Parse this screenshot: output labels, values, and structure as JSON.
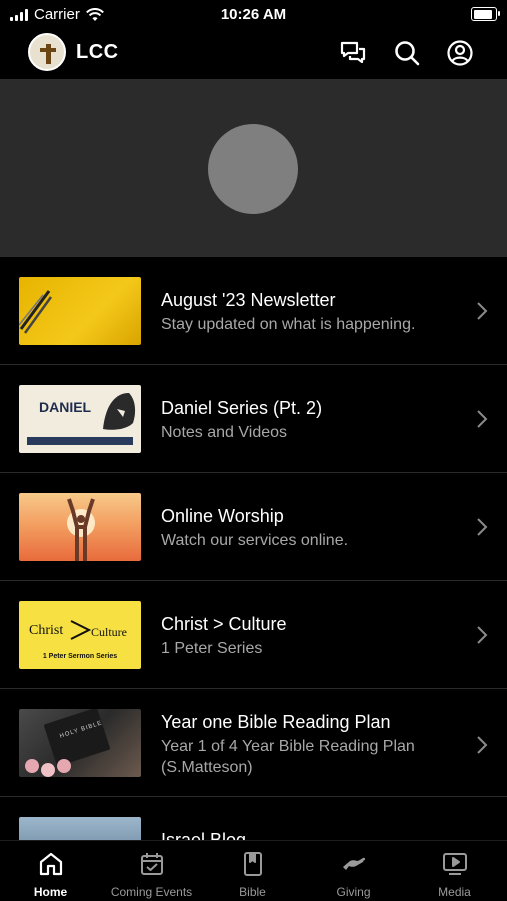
{
  "status_bar": {
    "carrier": "Carrier",
    "time": "10:26 AM",
    "battery_level": 1.0
  },
  "header": {
    "app_title": "LCC"
  },
  "list": {
    "items": [
      {
        "title": "August '23 Newsletter",
        "subtitle": "Stay updated on what is happening.",
        "thumb": "newsletter-pens"
      },
      {
        "title": "Daniel Series (Pt. 2)",
        "subtitle": "Notes and Videos",
        "thumb": "daniel-lion",
        "thumb_text": "DANIEL"
      },
      {
        "title": "Online Worship",
        "subtitle": "Watch our services online.",
        "thumb": "worship-sunset"
      },
      {
        "title": "Christ > Culture",
        "subtitle": "1 Peter Series",
        "thumb": "christ-culture",
        "thumb_text_left": "Christ",
        "thumb_text_right": "Culture",
        "thumb_caption": "1 Peter Sermon Series"
      },
      {
        "title": "Year one Bible Reading Plan",
        "subtitle": "Year 1 of 4 Year Bible Reading Plan (S.Matteson)",
        "thumb": "holy-bible",
        "thumb_text": "HOLY BIBLE"
      },
      {
        "title": "Israel Blog",
        "subtitle": "",
        "thumb": "israel-landscape"
      }
    ]
  },
  "tabs": [
    {
      "label": "Home",
      "icon": "home-icon",
      "active": true
    },
    {
      "label": "Coming Events",
      "icon": "calendar-icon",
      "active": false
    },
    {
      "label": "Bible",
      "icon": "book-icon",
      "active": false
    },
    {
      "label": "Giving",
      "icon": "giving-hand-icon",
      "active": false
    },
    {
      "label": "Media",
      "icon": "media-play-icon",
      "active": false
    }
  ]
}
